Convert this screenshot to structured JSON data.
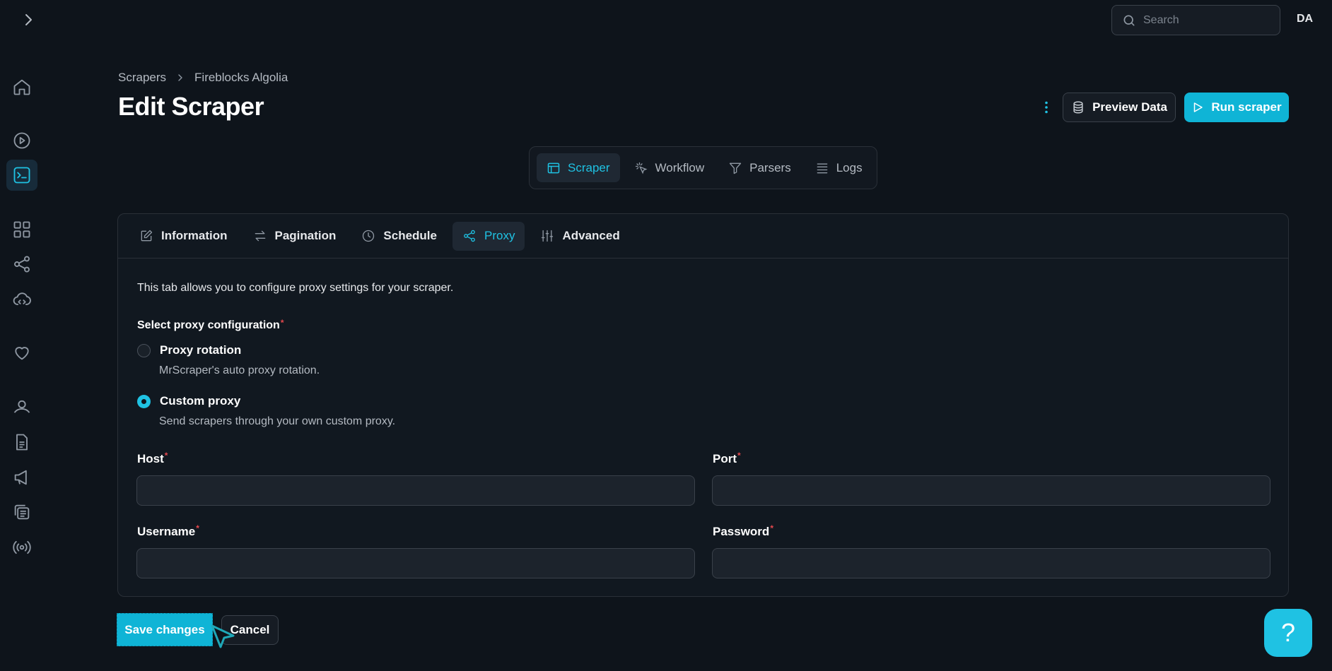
{
  "header": {
    "search_placeholder": "Search",
    "avatar_initials": "DA"
  },
  "sidebar": {
    "items": [
      {
        "name": "home"
      },
      {
        "name": "play-circle"
      },
      {
        "name": "terminal",
        "active": true
      },
      {
        "name": "apps-grid"
      },
      {
        "name": "share"
      },
      {
        "name": "cloud-code"
      },
      {
        "name": "heart"
      },
      {
        "name": "user"
      },
      {
        "name": "document"
      },
      {
        "name": "megaphone"
      },
      {
        "name": "copy"
      },
      {
        "name": "broadcast"
      }
    ]
  },
  "breadcrumb": {
    "root": "Scrapers",
    "current": "Fireblocks Algolia"
  },
  "page": {
    "title": "Edit Scraper",
    "preview_label": "Preview Data",
    "run_label": "Run scraper"
  },
  "top_tabs": [
    {
      "label": "Scraper",
      "active": true
    },
    {
      "label": "Workflow"
    },
    {
      "label": "Parsers"
    },
    {
      "label": "Logs"
    }
  ],
  "sub_tabs": [
    {
      "label": "Information"
    },
    {
      "label": "Pagination"
    },
    {
      "label": "Schedule"
    },
    {
      "label": "Proxy",
      "active": true
    },
    {
      "label": "Advanced"
    }
  ],
  "proxy": {
    "description": "This tab allows you to configure proxy settings for your scraper.",
    "config_label": "Select proxy configuration",
    "options": [
      {
        "label": "Proxy rotation",
        "help": "MrScraper's auto proxy rotation.",
        "checked": false
      },
      {
        "label": "Custom proxy",
        "help": "Send scrapers through your own custom proxy.",
        "checked": true
      }
    ],
    "fields": {
      "host_label": "Host",
      "host_value": "",
      "port_label": "Port",
      "port_value": "",
      "username_label": "Username",
      "username_value": "",
      "password_label": "Password",
      "password_value": ""
    },
    "required_marker": "*"
  },
  "actions": {
    "save_label": "Save changes",
    "cancel_label": "Cancel"
  },
  "help_fab": "?",
  "colors": {
    "accent": "#1fc2e3",
    "button_primary": "#0fb4d6",
    "background": "#0e141b",
    "required": "#e5484d"
  }
}
